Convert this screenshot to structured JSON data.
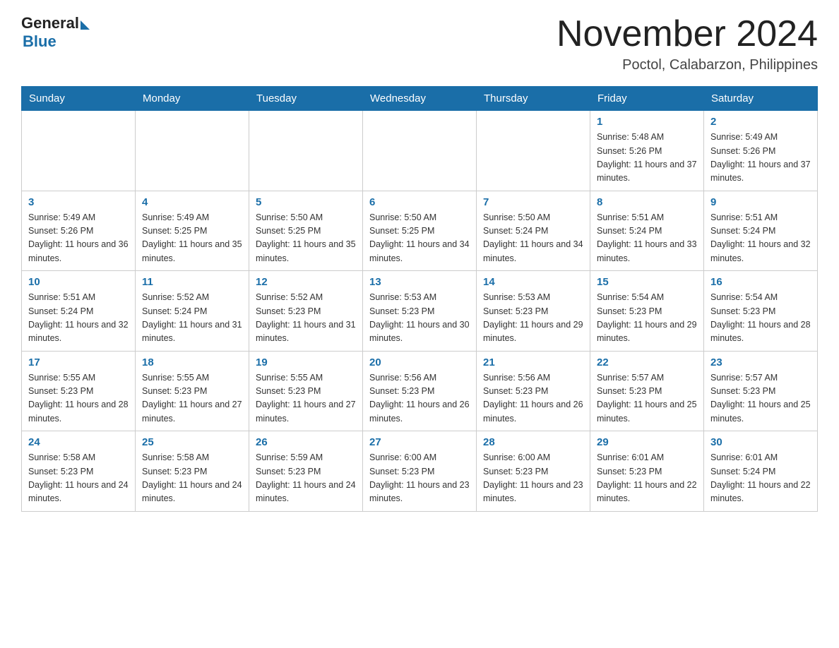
{
  "logo": {
    "general": "General",
    "blue": "Blue"
  },
  "header": {
    "month_year": "November 2024",
    "location": "Poctol, Calabarzon, Philippines"
  },
  "days_of_week": [
    "Sunday",
    "Monday",
    "Tuesday",
    "Wednesday",
    "Thursday",
    "Friday",
    "Saturday"
  ],
  "weeks": [
    [
      {
        "day": "",
        "info": ""
      },
      {
        "day": "",
        "info": ""
      },
      {
        "day": "",
        "info": ""
      },
      {
        "day": "",
        "info": ""
      },
      {
        "day": "",
        "info": ""
      },
      {
        "day": "1",
        "info": "Sunrise: 5:48 AM\nSunset: 5:26 PM\nDaylight: 11 hours and 37 minutes."
      },
      {
        "day": "2",
        "info": "Sunrise: 5:49 AM\nSunset: 5:26 PM\nDaylight: 11 hours and 37 minutes."
      }
    ],
    [
      {
        "day": "3",
        "info": "Sunrise: 5:49 AM\nSunset: 5:26 PM\nDaylight: 11 hours and 36 minutes."
      },
      {
        "day": "4",
        "info": "Sunrise: 5:49 AM\nSunset: 5:25 PM\nDaylight: 11 hours and 35 minutes."
      },
      {
        "day": "5",
        "info": "Sunrise: 5:50 AM\nSunset: 5:25 PM\nDaylight: 11 hours and 35 minutes."
      },
      {
        "day": "6",
        "info": "Sunrise: 5:50 AM\nSunset: 5:25 PM\nDaylight: 11 hours and 34 minutes."
      },
      {
        "day": "7",
        "info": "Sunrise: 5:50 AM\nSunset: 5:24 PM\nDaylight: 11 hours and 34 minutes."
      },
      {
        "day": "8",
        "info": "Sunrise: 5:51 AM\nSunset: 5:24 PM\nDaylight: 11 hours and 33 minutes."
      },
      {
        "day": "9",
        "info": "Sunrise: 5:51 AM\nSunset: 5:24 PM\nDaylight: 11 hours and 32 minutes."
      }
    ],
    [
      {
        "day": "10",
        "info": "Sunrise: 5:51 AM\nSunset: 5:24 PM\nDaylight: 11 hours and 32 minutes."
      },
      {
        "day": "11",
        "info": "Sunrise: 5:52 AM\nSunset: 5:24 PM\nDaylight: 11 hours and 31 minutes."
      },
      {
        "day": "12",
        "info": "Sunrise: 5:52 AM\nSunset: 5:23 PM\nDaylight: 11 hours and 31 minutes."
      },
      {
        "day": "13",
        "info": "Sunrise: 5:53 AM\nSunset: 5:23 PM\nDaylight: 11 hours and 30 minutes."
      },
      {
        "day": "14",
        "info": "Sunrise: 5:53 AM\nSunset: 5:23 PM\nDaylight: 11 hours and 29 minutes."
      },
      {
        "day": "15",
        "info": "Sunrise: 5:54 AM\nSunset: 5:23 PM\nDaylight: 11 hours and 29 minutes."
      },
      {
        "day": "16",
        "info": "Sunrise: 5:54 AM\nSunset: 5:23 PM\nDaylight: 11 hours and 28 minutes."
      }
    ],
    [
      {
        "day": "17",
        "info": "Sunrise: 5:55 AM\nSunset: 5:23 PM\nDaylight: 11 hours and 28 minutes."
      },
      {
        "day": "18",
        "info": "Sunrise: 5:55 AM\nSunset: 5:23 PM\nDaylight: 11 hours and 27 minutes."
      },
      {
        "day": "19",
        "info": "Sunrise: 5:55 AM\nSunset: 5:23 PM\nDaylight: 11 hours and 27 minutes."
      },
      {
        "day": "20",
        "info": "Sunrise: 5:56 AM\nSunset: 5:23 PM\nDaylight: 11 hours and 26 minutes."
      },
      {
        "day": "21",
        "info": "Sunrise: 5:56 AM\nSunset: 5:23 PM\nDaylight: 11 hours and 26 minutes."
      },
      {
        "day": "22",
        "info": "Sunrise: 5:57 AM\nSunset: 5:23 PM\nDaylight: 11 hours and 25 minutes."
      },
      {
        "day": "23",
        "info": "Sunrise: 5:57 AM\nSunset: 5:23 PM\nDaylight: 11 hours and 25 minutes."
      }
    ],
    [
      {
        "day": "24",
        "info": "Sunrise: 5:58 AM\nSunset: 5:23 PM\nDaylight: 11 hours and 24 minutes."
      },
      {
        "day": "25",
        "info": "Sunrise: 5:58 AM\nSunset: 5:23 PM\nDaylight: 11 hours and 24 minutes."
      },
      {
        "day": "26",
        "info": "Sunrise: 5:59 AM\nSunset: 5:23 PM\nDaylight: 11 hours and 24 minutes."
      },
      {
        "day": "27",
        "info": "Sunrise: 6:00 AM\nSunset: 5:23 PM\nDaylight: 11 hours and 23 minutes."
      },
      {
        "day": "28",
        "info": "Sunrise: 6:00 AM\nSunset: 5:23 PM\nDaylight: 11 hours and 23 minutes."
      },
      {
        "day": "29",
        "info": "Sunrise: 6:01 AM\nSunset: 5:23 PM\nDaylight: 11 hours and 22 minutes."
      },
      {
        "day": "30",
        "info": "Sunrise: 6:01 AM\nSunset: 5:24 PM\nDaylight: 11 hours and 22 minutes."
      }
    ]
  ]
}
